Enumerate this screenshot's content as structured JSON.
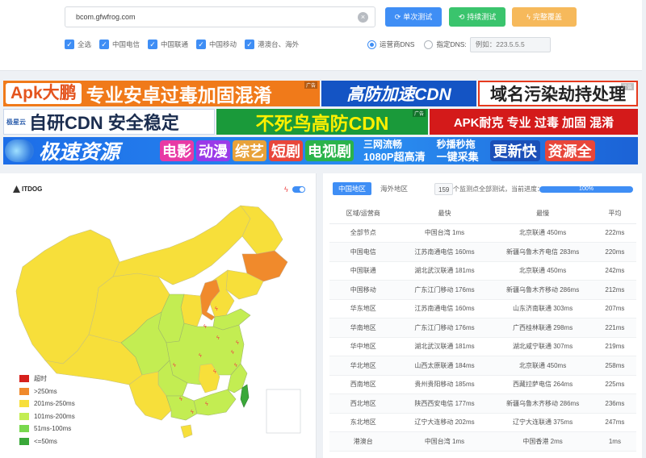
{
  "search": {
    "value": "bcom.gfwfrog.com",
    "placeholder": ""
  },
  "buttons": {
    "single": "单次测试",
    "continuous": "持续测试",
    "full": "完整覆盖"
  },
  "filters": [
    "全选",
    "中国电信",
    "中国联通",
    "中国移动",
    "港澳台、海外"
  ],
  "dns": {
    "operator_label": "运营商DNS",
    "custom_label": "指定DNS:",
    "custom_placeholder": "例如：223.5.5.5",
    "selected": "运营商DNS"
  },
  "banners": {
    "row1": [
      {
        "left": "Apk大鹏",
        "right": "专业安卓过毒加固混淆",
        "tag": "广告"
      },
      {
        "text": "高防加速CDN"
      },
      {
        "text": "域名污染劫持处理",
        "tag": "广告"
      }
    ],
    "row2": [
      {
        "brand": "极星云",
        "text": "自研CDN 安全稳定"
      },
      {
        "text": "不死鸟高防CDN",
        "tag": "广告"
      },
      {
        "text": "APK耐克 专业 过毒 加固 混淆"
      }
    ],
    "row3": [
      {
        "text": "极速资源"
      },
      {
        "tags": [
          "电影",
          "动漫",
          "综艺",
          "短剧",
          "电视剧"
        ]
      },
      {
        "top": "三网流畅",
        "bottom": "1080P超高清",
        "top2": "秒播秒拖",
        "bottom2": "一键采集"
      },
      {
        "text": "更新快"
      },
      {
        "text": "资源全"
      }
    ]
  },
  "map": {
    "logo": "ITDOG",
    "legend": [
      {
        "label": "超时",
        "color": "#d6201c"
      },
      {
        "label": ">250ms",
        "color": "#f08a2c"
      },
      {
        "label": "201ms-250ms",
        "color": "#f7df3a"
      },
      {
        "label": "101ms-200ms",
        "color": "#c3ed52"
      },
      {
        "label": "51ms-100ms",
        "color": "#78d84e"
      },
      {
        "label": "<=50ms",
        "color": "#3aa839"
      }
    ]
  },
  "results": {
    "tabs": [
      "中国地区",
      "海外地区"
    ],
    "node_count": "159",
    "progress_label": "个监测点全部测试，当前进度：",
    "progress_percent": 100,
    "progress_text": "100%",
    "columns": [
      "区域/运营商",
      "最快",
      "最慢",
      "平均"
    ],
    "rows": [
      [
        "全部节点",
        "中国台湾 1ms",
        "北京联通 450ms",
        "222ms"
      ],
      [
        "中国电信",
        "江苏南通电信 160ms",
        "新疆乌鲁木齐电信 283ms",
        "220ms"
      ],
      [
        "中国联通",
        "湖北武汉联通 181ms",
        "北京联通 450ms",
        "242ms"
      ],
      [
        "中国移动",
        "广东江门移动 176ms",
        "新疆乌鲁木齐移动 286ms",
        "212ms"
      ],
      [
        "华东地区",
        "江苏南通电信 160ms",
        "山东济南联通 303ms",
        "207ms"
      ],
      [
        "华南地区",
        "广东江门移动 176ms",
        "广西桂林联通 298ms",
        "221ms"
      ],
      [
        "华中地区",
        "湖北武汉联通 181ms",
        "湖北咸宁联通 307ms",
        "219ms"
      ],
      [
        "华北地区",
        "山西太原联通 184ms",
        "北京联通 450ms",
        "258ms"
      ],
      [
        "西南地区",
        "贵州贵阳移动 185ms",
        "西藏拉萨电信 264ms",
        "225ms"
      ],
      [
        "西北地区",
        "陕西西安电信 177ms",
        "新疆乌鲁木齐移动 286ms",
        "236ms"
      ],
      [
        "东北地区",
        "辽宁大连移动 202ms",
        "辽宁大连联通 375ms",
        "247ms"
      ],
      [
        "港澳台",
        "中国台湾 1ms",
        "中国香港 2ms",
        "1ms"
      ]
    ]
  }
}
